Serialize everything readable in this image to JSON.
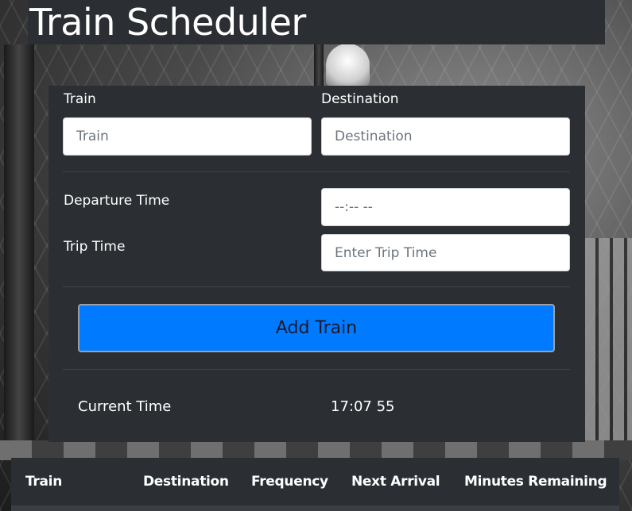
{
  "app": {
    "title": "Train Scheduler"
  },
  "form": {
    "train_label": "Train",
    "train_placeholder": "Train",
    "destination_label": "Destination",
    "destination_placeholder": "Destination",
    "departure_label": "Departure Time",
    "departure_value": "--:-- --",
    "trip_label": "Trip Time",
    "trip_placeholder": "Enter Trip Time",
    "add_button": "Add Train"
  },
  "clock": {
    "label": "Current Time",
    "value": "17:07 55"
  },
  "table": {
    "headers": [
      "Train",
      "Destination",
      "Frequency",
      "Next Arrival",
      "Minutes Remaining"
    ]
  }
}
